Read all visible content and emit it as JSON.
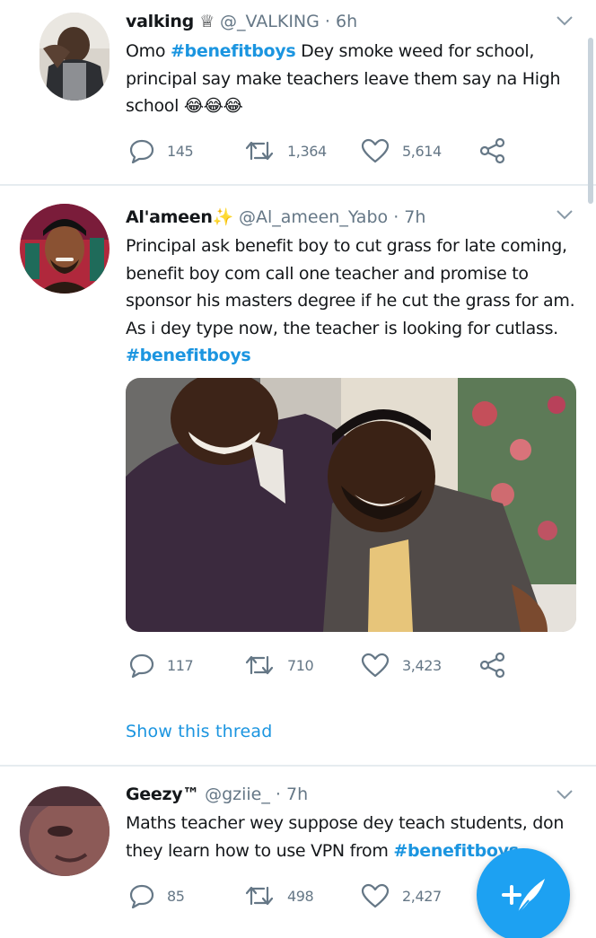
{
  "tweets": [
    {
      "display_name": "valking ♕",
      "handle": "@_VALKING",
      "separator": "·",
      "time": "6h",
      "text_before": "Omo ",
      "hashtag": "#benefitboys",
      "text_after": " Dey smoke weed for school, principal say make teachers leave them say na High school 😂😂😂",
      "replies": "145",
      "retweets": "1,364",
      "likes": "5,614"
    },
    {
      "display_name": "Al'ameen✨",
      "handle": "@Al_ameen_Yabo",
      "separator": "·",
      "time": "7h",
      "text_before": "Principal ask benefit boy to cut grass for late coming, benefit boy com call one teacher and promise to sponsor his masters degree if he cut the grass for am. As i dey type now, the teacher is looking for cutlass. ",
      "hashtag": "#benefitboys",
      "text_after": "",
      "replies": "117",
      "retweets": "710",
      "likes": "3,423",
      "show_thread": "Show this thread"
    },
    {
      "display_name": "Geezy™",
      "handle": "@gziie_",
      "separator": "·",
      "time": "7h",
      "text_before": "Maths teacher wey suppose dey teach students, don they learn how to use VPN from ",
      "hashtag": "#benefitboys",
      "text_after": "",
      "replies": "85",
      "retweets": "498",
      "likes": "2,427"
    }
  ],
  "colors": {
    "accent": "#1da1f2",
    "link": "#1b95e0",
    "muted": "#657786",
    "divider": "#e6ecf0"
  },
  "icons": [
    "reply-icon",
    "retweet-icon",
    "like-icon",
    "share-icon",
    "caret-down-icon",
    "compose-tweet-icon"
  ]
}
